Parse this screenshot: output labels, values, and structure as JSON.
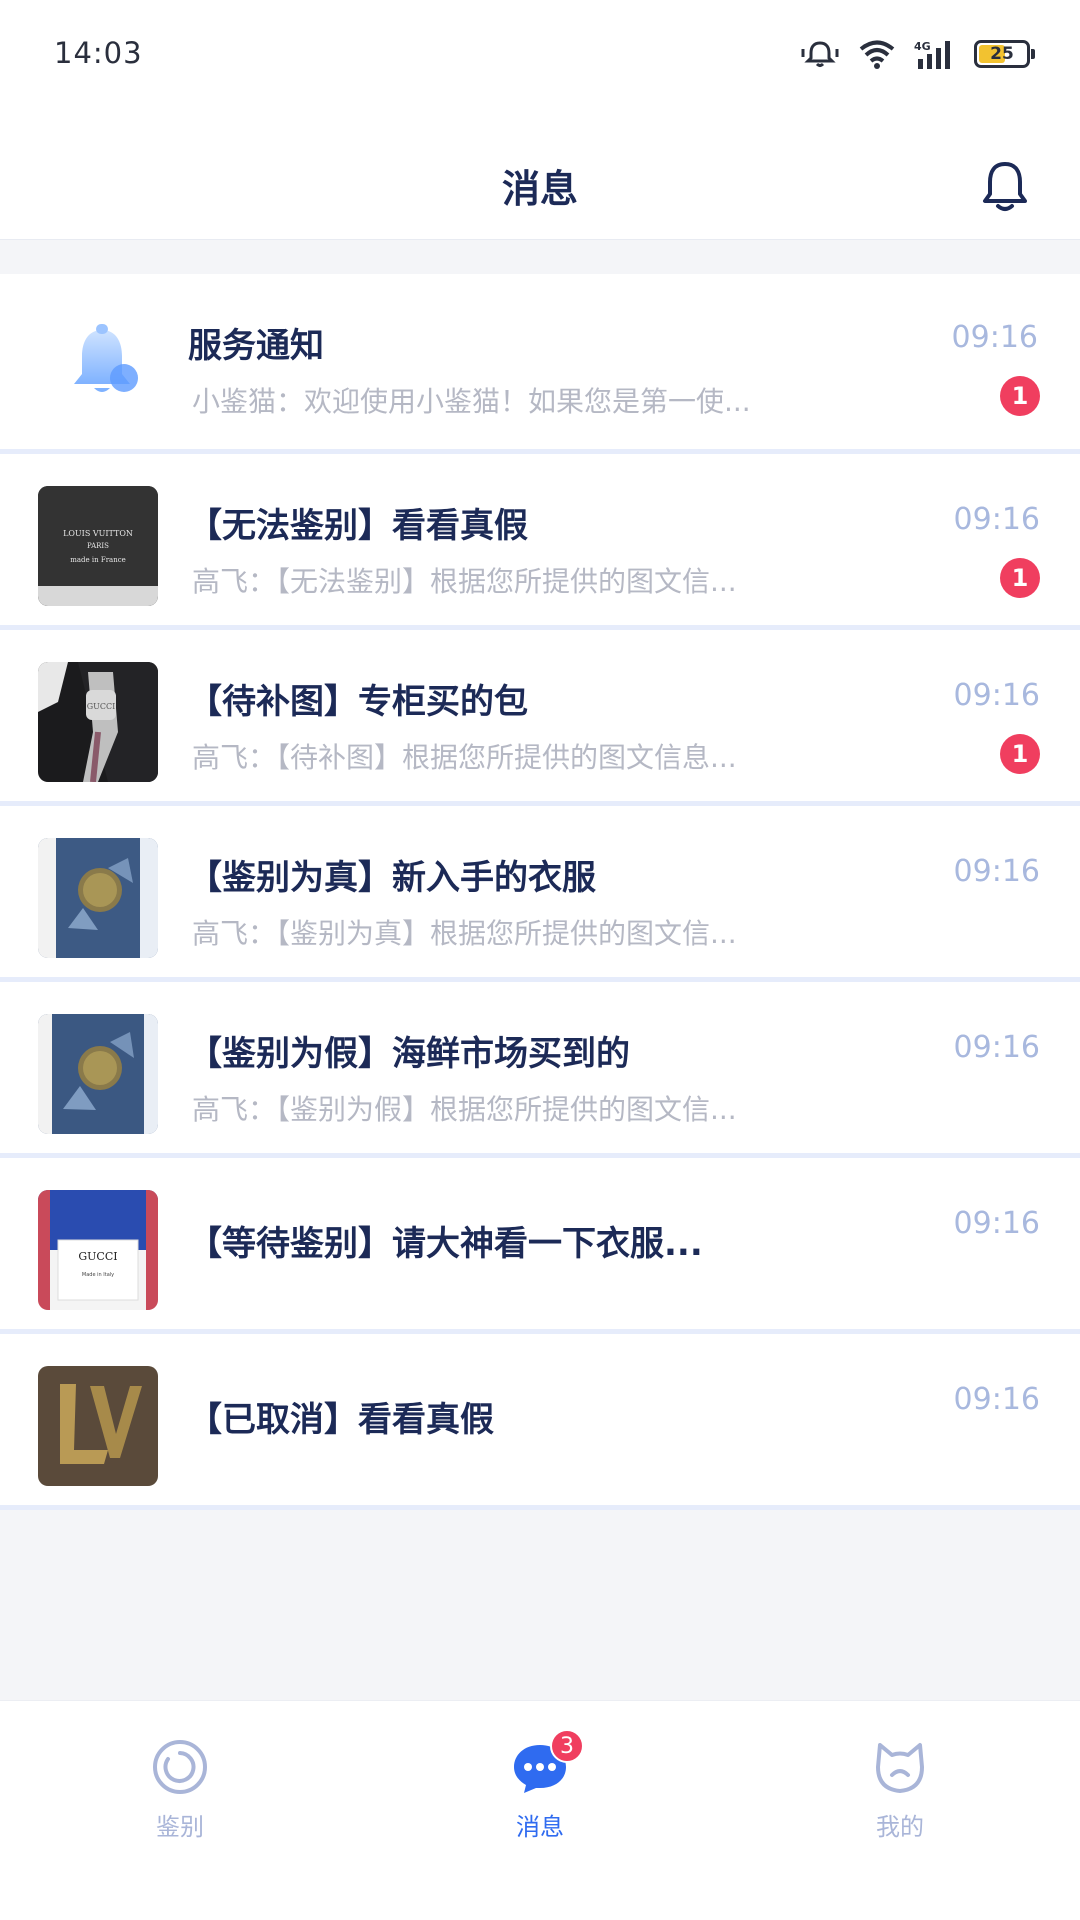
{
  "status_bar": {
    "time": "14:03",
    "battery": "25"
  },
  "nav": {
    "title": "消息"
  },
  "messages": [
    {
      "title": "服务通知",
      "preview": "小鉴猫：欢迎使用小鉴猫！如果您是第一使...",
      "time": "09:16",
      "badge": "1"
    },
    {
      "title": "【无法鉴别】看看真假",
      "preview": "高飞：【无法鉴别】根据您所提供的图文信...",
      "time": "09:16",
      "badge": "1"
    },
    {
      "title": "【待补图】专柜买的包",
      "preview": "高飞：【待补图】根据您所提供的图文信息...",
      "time": "09:16",
      "badge": "1"
    },
    {
      "title": "【鉴别为真】新入手的衣服",
      "preview": "高飞：【鉴别为真】根据您所提供的图文信...",
      "time": "09:16"
    },
    {
      "title": "【鉴别为假】海鲜市场买到的",
      "preview": "高飞：【鉴别为假】根据您所提供的图文信...",
      "time": "09:16"
    },
    {
      "title": "【等待鉴别】请大神看一下衣服...",
      "time": "09:16"
    },
    {
      "title": "【已取消】看看真假",
      "time": "09:16"
    }
  ],
  "tabs": [
    {
      "label": "鉴别",
      "icon": "identify-icon"
    },
    {
      "label": "消息",
      "icon": "chat-icon",
      "badge": "3"
    },
    {
      "label": "我的",
      "icon": "cat-profile-icon"
    }
  ],
  "thumb_texts": {
    "lv_wallet": [
      "LOUIS VUITTON",
      "PARIS",
      "made in France"
    ],
    "gucci_zip": "GUCCI",
    "gucci_label": [
      "GUCCI",
      "Made in Italy"
    ]
  },
  "colors": {
    "primary": "#2f6bf0",
    "title": "#1c2a57",
    "badge": "#f03e5f",
    "time": "#a8b8de"
  }
}
